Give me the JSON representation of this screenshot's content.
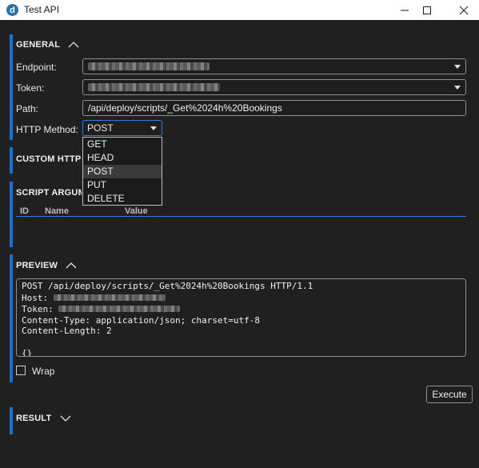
{
  "window": {
    "title": "Test API",
    "app_icon": "d",
    "minimize_icon": "minimize-icon",
    "maximize_icon": "maximize-icon",
    "close_icon": "close-icon"
  },
  "general": {
    "title": "GENERAL",
    "endpoint_label": "Endpoint:",
    "token_label": "Token:",
    "path_label": "Path:",
    "path_value": "/api/deploy/scripts/_Get%2024h%20Bookings",
    "method_label": "HTTP Method:",
    "method_value": "POST",
    "method_options": [
      "GET",
      "HEAD",
      "POST",
      "PUT",
      "DELETE"
    ],
    "selected_option": "POST"
  },
  "custom_headers": {
    "title": "CUSTOM HTTP H"
  },
  "script_arguments": {
    "title": "SCRIPT ARGUME",
    "columns": [
      "ID",
      "Name",
      "Value"
    ]
  },
  "preview": {
    "title": "PREVIEW",
    "line1": "POST /api/deploy/scripts/_Get%2024h%20Bookings HTTP/1.1",
    "host_label": "Host: ",
    "token_label": "Token: ",
    "line4": "Content-Type: application/json; charset=utf-8",
    "line5": "Content-Length: 2",
    "line7": "{}"
  },
  "wrap_label": "Wrap",
  "wrap_checked": false,
  "execute_label": "Execute",
  "result": {
    "title": "RESULT"
  },
  "colors": {
    "accent": "#1f6fc6",
    "background": "#202020",
    "titlebar": "#ffffff"
  }
}
